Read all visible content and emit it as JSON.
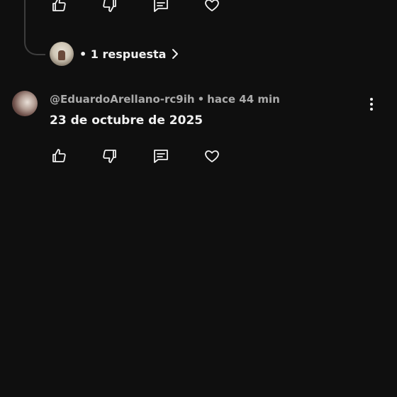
{
  "previous_comment": {
    "actions": {
      "like_icon": "thumbs-up-icon",
      "dislike_icon": "thumbs-down-icon",
      "reply_icon": "comment-icon",
      "heart_icon": "heart-icon"
    },
    "replies": {
      "label": "• 1 respuesta",
      "icon": "chevron-right-icon"
    }
  },
  "comment": {
    "author": "@EduardoArellano-rc9ih",
    "separator": "•",
    "time": "hace 44 min",
    "text": "23 de octubre de 2025",
    "actions": {
      "like_icon": "thumbs-up-icon",
      "dislike_icon": "thumbs-down-icon",
      "reply_icon": "comment-icon",
      "heart_icon": "heart-icon"
    },
    "menu_icon": "more-vert-icon"
  },
  "colors": {
    "background": "#0f0f0f",
    "primary_text": "#f1f1f1",
    "secondary_text": "#aaaaaa",
    "thread_line": "#3d3d3d"
  }
}
